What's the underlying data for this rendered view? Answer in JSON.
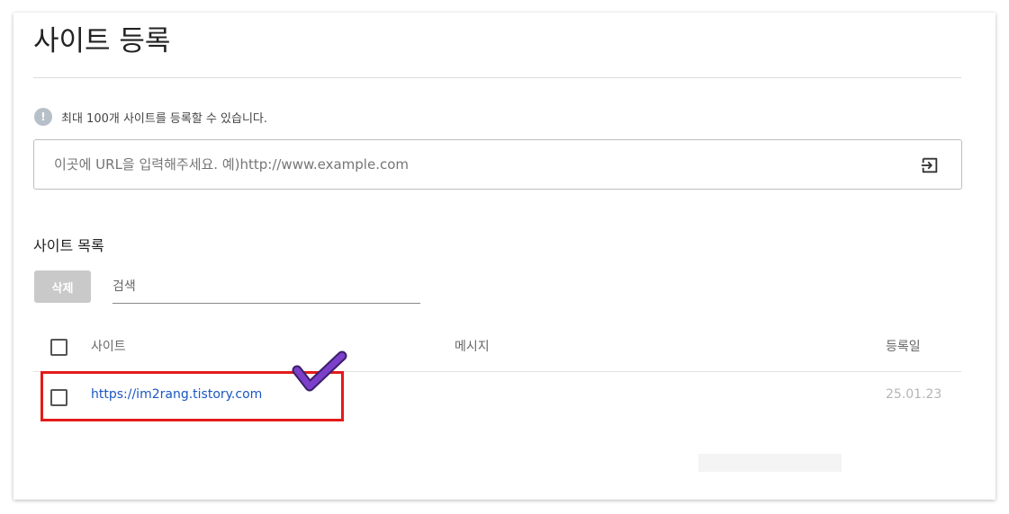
{
  "page": {
    "title": "사이트 등록",
    "notice": "최대 100개 사이트를 등록할 수 있습니다.",
    "notice_icon": "info-icon"
  },
  "url_form": {
    "placeholder": "이곳에 URL을 입력해주세요. 예)http://www.example.com",
    "value": "",
    "submit_icon": "login-enter-icon"
  },
  "site_list": {
    "title": "사이트 목록",
    "delete_label": "삭제",
    "search_placeholder": "검색",
    "columns": {
      "site": "사이트",
      "message": "메시지",
      "registered": "등록일"
    },
    "rows": [
      {
        "site": "https://im2rang.tistory.com",
        "message": "",
        "registered": "25.01.23",
        "checked": false
      }
    ]
  },
  "colors": {
    "link": "#1a56c2",
    "highlight": "#e31b1b",
    "check_mark": "#7b3fc9",
    "delete_button": "#c9c9c9"
  },
  "annotations": {
    "highlight_box_color": "#e31b1b",
    "check_mark_icon": "check-mark-icon"
  }
}
